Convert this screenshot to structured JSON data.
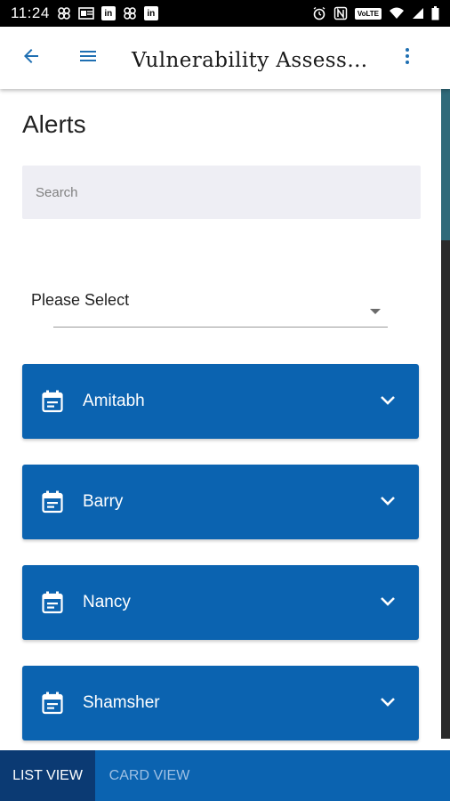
{
  "status_bar": {
    "time": "11:24",
    "left_icons": [
      "pinwheel-icon",
      "outlook-icon",
      "linkedin-icon",
      "pinwheel-icon",
      "linkedin-icon"
    ],
    "right_icons": [
      "alarm-icon",
      "nfc-icon",
      "volte-icon",
      "wifi-icon",
      "signal-icon",
      "battery-icon"
    ],
    "linkedin_text": "in",
    "volte_text": "VoLTE"
  },
  "app_bar": {
    "back_icon": "arrow-back-icon",
    "menu_icon": "hamburger-menu-icon",
    "title": "Vulnerability Assess…",
    "more_icon": "more-vertical-icon"
  },
  "page": {
    "heading": "Alerts",
    "search_placeholder": "Search",
    "select_value": "Please Select"
  },
  "alerts": [
    {
      "name": "Amitabh"
    },
    {
      "name": "Barry"
    },
    {
      "name": "Nancy"
    },
    {
      "name": "Shamsher"
    }
  ],
  "bottom_tabs": [
    {
      "label": "LIST VIEW",
      "active": true
    },
    {
      "label": "CARD VIEW",
      "active": false
    }
  ],
  "colors": {
    "primary": "#0b63b0",
    "active_tab": "#0b3a73",
    "accent_icon": "#1f6fb2",
    "search_bg": "#eeeef4"
  }
}
